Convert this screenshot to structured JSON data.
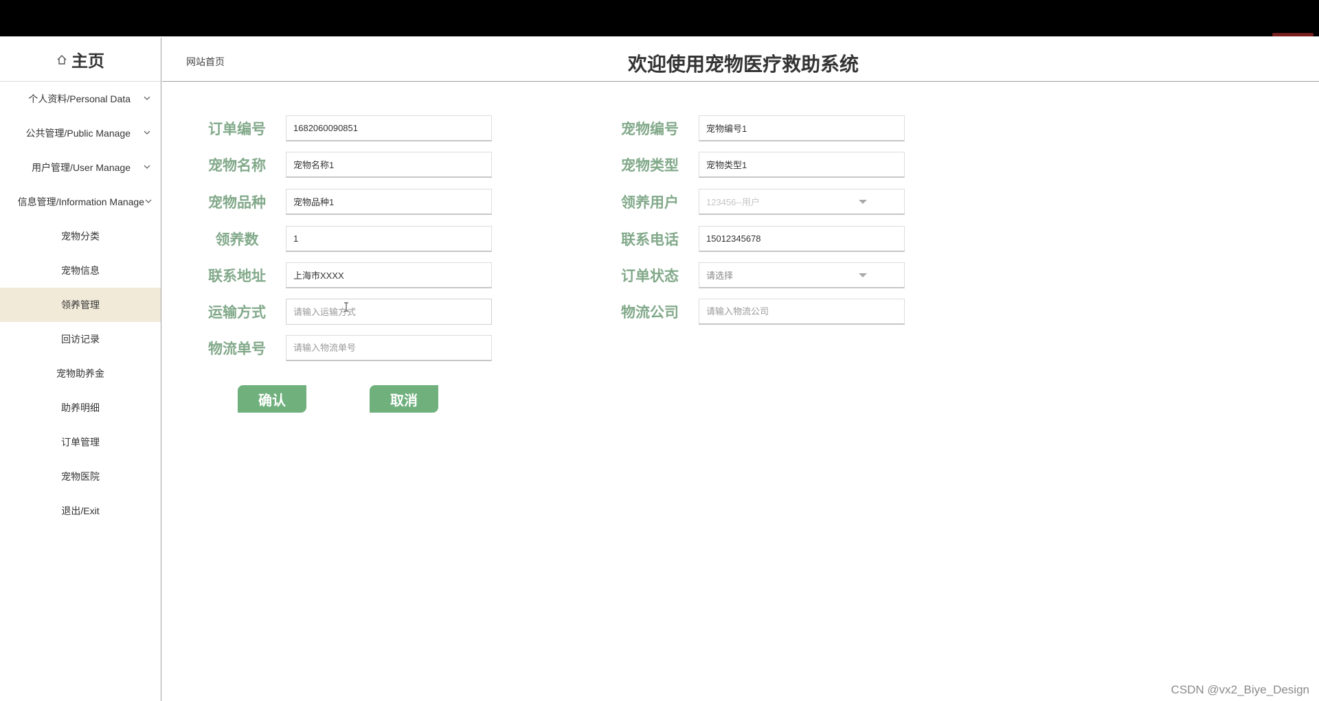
{
  "header": {
    "home_label": "主页",
    "breadcrumb": "网站首页",
    "title": "欢迎使用宠物医疗救助系统"
  },
  "sidebar": {
    "items": [
      {
        "label": "个人资料/Personal Data",
        "expandable": true
      },
      {
        "label": "公共管理/Public Manage",
        "expandable": true
      },
      {
        "label": "用户管理/User Manage",
        "expandable": true
      },
      {
        "label": "信息管理/Information Manage",
        "expandable": true
      },
      {
        "label": "宠物分类"
      },
      {
        "label": "宠物信息"
      },
      {
        "label": "领养管理",
        "active": true
      },
      {
        "label": "回访记录"
      },
      {
        "label": "宠物助养金"
      },
      {
        "label": "助养明细"
      },
      {
        "label": "订单管理"
      },
      {
        "label": "宠物医院"
      },
      {
        "label": "退出/Exit"
      }
    ]
  },
  "form": {
    "order_no": {
      "label": "订单编号",
      "value": "1682060090851"
    },
    "pet_no": {
      "label": "宠物编号",
      "value": "宠物编号1"
    },
    "pet_name": {
      "label": "宠物名称",
      "value": "宠物名称1"
    },
    "pet_type": {
      "label": "宠物类型",
      "value": "宠物类型1"
    },
    "pet_breed": {
      "label": "宠物品种",
      "value": "宠物品种1"
    },
    "adopt_user": {
      "label": "领养用户",
      "value": "123456--用户"
    },
    "adopt_count": {
      "label": "领养数",
      "value": "1"
    },
    "phone": {
      "label": "联系电话",
      "value": "15012345678"
    },
    "address": {
      "label": "联系地址",
      "value": "上海市XXXX"
    },
    "order_status": {
      "label": "订单状态",
      "value": "请选择"
    },
    "shipping": {
      "label": "运输方式",
      "placeholder": "请输入运输方式"
    },
    "logistics_company": {
      "label": "物流公司",
      "placeholder": "请输入物流公司"
    },
    "tracking_no": {
      "label": "物流单号",
      "placeholder": "请输入物流单号"
    }
  },
  "buttons": {
    "confirm": "确认",
    "cancel": "取消"
  },
  "watermark": "CSDN @vx2_Biye_Design",
  "colors": {
    "label": "#82a98a",
    "button": "#6fb07d",
    "active_nav": "#f1ead9"
  }
}
